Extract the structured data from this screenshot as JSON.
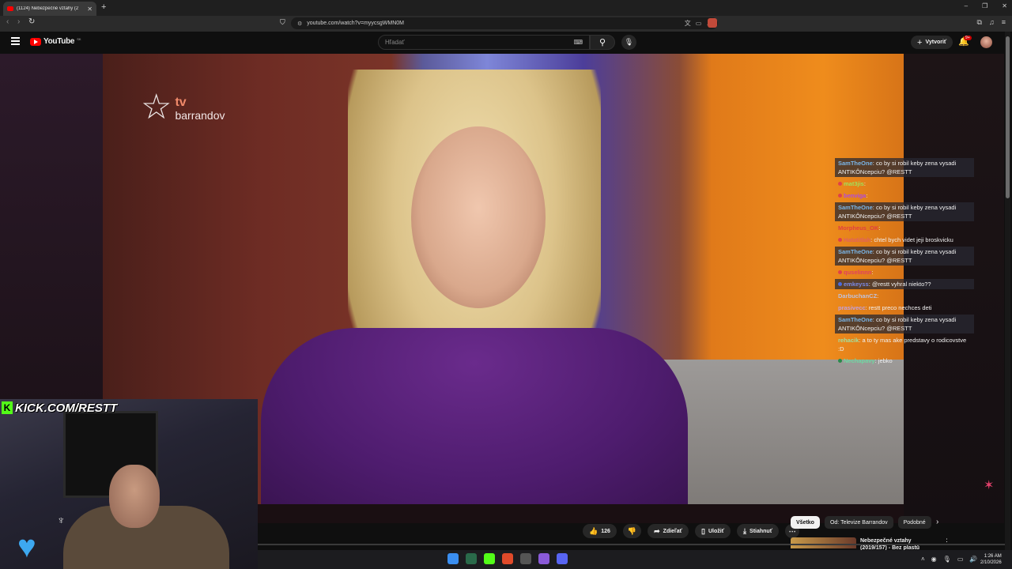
{
  "browser": {
    "tab_title": "(1124) Nebezpečné vztahy (2",
    "tab_close": "✕",
    "new_tab": "+",
    "url": "youtube.com/watch?v=myycsgWMN0M",
    "window_controls": [
      "–",
      "❐",
      "✕"
    ]
  },
  "youtube": {
    "logo_text": "YouTube",
    "country_code": "SK",
    "search_placeholder": "Hľadať",
    "create_label": "Vytvoriť",
    "notifications_badge": "9+"
  },
  "video": {
    "channel_logo_tv": "tv",
    "channel_logo_name": "barrandov"
  },
  "stream": {
    "kick_url": "KICK.COM/RESTT"
  },
  "chat": [
    {
      "user": "SamTheOne",
      "user_color": "#7ab6e8",
      "text": "co by si robil keby zena vysadi ANTIKÔNcepciu? @RESTT",
      "highlight": true,
      "badge": ""
    },
    {
      "user": "mat3jis",
      "user_color": "#a0e05a",
      "text": "",
      "highlight": false,
      "badge": "#e0404a"
    },
    {
      "user": "benviga",
      "user_color": "#b04ae0",
      "text": "",
      "highlight": false,
      "badge": "#e0404a"
    },
    {
      "user": "SamTheOne",
      "user_color": "#7ab6e8",
      "text": "co by si robil keby zena vysadi ANTIKÔNcepciu? @RESTT",
      "highlight": true,
      "badge": ""
    },
    {
      "user": "Morpheus_OK",
      "user_color": "#e04040",
      "text": "",
      "highlight": false,
      "badge": ""
    },
    {
      "user": "Hatatitlah",
      "user_color": "#e06060",
      "text": "chtel bych videt jeji broskvicku",
      "highlight": false,
      "badge": "#e0404a"
    },
    {
      "user": "SamTheOne",
      "user_color": "#7ab6e8",
      "text": "co by si robil keby zena vysadi ANTIKÔNcepciu? @RESTT",
      "highlight": true,
      "badge": ""
    },
    {
      "user": "quselinnn",
      "user_color": "#e04060",
      "text": "",
      "highlight": false,
      "badge": "#e0404a"
    },
    {
      "user": "emkeyss",
      "user_color": "#7a8ae8",
      "text": "@restt vyhral niekto??",
      "highlight": true,
      "badge": "#4a6ae0"
    },
    {
      "user": "DarbuchanCZ",
      "user_color": "#c0c0d8",
      "text": "",
      "highlight": false,
      "badge": ""
    },
    {
      "user": "prasivecc",
      "user_color": "#c0a0e0",
      "text": "restt preco nechces deti",
      "highlight": false,
      "badge": ""
    },
    {
      "user": "SamTheOne",
      "user_color": "#7ab6e8",
      "text": "co by si robil keby zena vysadi ANTIKÔNcepciu? @RESTT",
      "highlight": true,
      "badge": ""
    },
    {
      "user": "rehacik",
      "user_color": "#a0e0a0",
      "text": "a to ty mas ake predstavy o rodicovstve :D",
      "highlight": false,
      "badge": ""
    },
    {
      "user": "Nechapavy",
      "user_color": "#70d8a0",
      "text": "jebko",
      "highlight": false,
      "badge": "#2a8a4a"
    }
  ],
  "actions": {
    "like_count": "126",
    "share_label": "Zdieľať",
    "save_label": "Uložiť",
    "download_label": "Stiahnuť"
  },
  "chips": [
    "Všetko",
    "Od: Televize Barrandov",
    "Podobné"
  ],
  "suggestion": {
    "title": "Nebezpečné vztahy (2019/157) - Bez plastů"
  },
  "taskbar": {
    "time": "1:26 AM",
    "date": "2/10/2026"
  },
  "colors": {
    "yt_red": "#ff0000",
    "kick_green": "#53fc18",
    "chip_active": "#f1f1f1"
  }
}
